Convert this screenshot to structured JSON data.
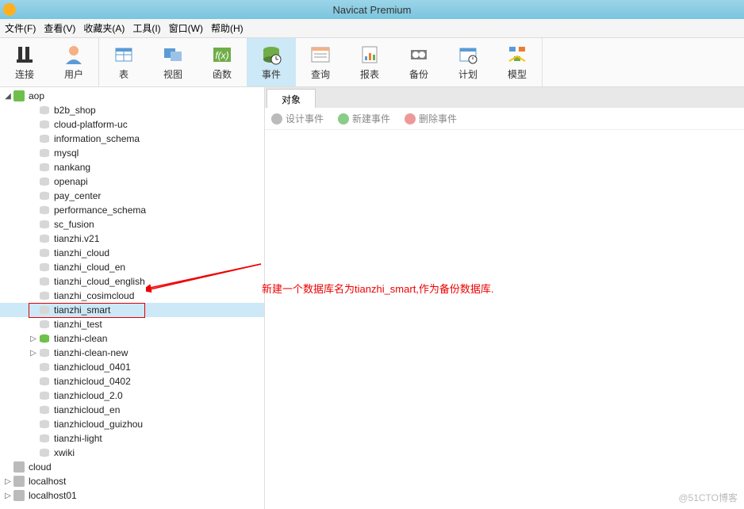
{
  "title": "Navicat Premium",
  "menu": [
    "文件(F)",
    "查看(V)",
    "收藏夹(A)",
    "工具(I)",
    "窗口(W)",
    "帮助(H)"
  ],
  "toolbar": [
    {
      "label": "连接",
      "icon": "plug"
    },
    {
      "label": "用户",
      "icon": "user"
    },
    {
      "label": "表",
      "icon": "table"
    },
    {
      "label": "视图",
      "icon": "view"
    },
    {
      "label": "函数",
      "icon": "fx"
    },
    {
      "label": "事件",
      "icon": "event",
      "active": true
    },
    {
      "label": "查询",
      "icon": "query"
    },
    {
      "label": "报表",
      "icon": "report"
    },
    {
      "label": "备份",
      "icon": "backup"
    },
    {
      "label": "计划",
      "icon": "plan"
    },
    {
      "label": "模型",
      "icon": "model"
    }
  ],
  "tree": {
    "connections": [
      {
        "name": "aop",
        "open": true,
        "active": true,
        "dbs": [
          {
            "name": "b2b_shop"
          },
          {
            "name": "cloud-platform-uc"
          },
          {
            "name": "information_schema"
          },
          {
            "name": "mysql"
          },
          {
            "name": "nankang"
          },
          {
            "name": "openapi"
          },
          {
            "name": "pay_center"
          },
          {
            "name": "performance_schema"
          },
          {
            "name": "sc_fusion"
          },
          {
            "name": "tianzhi.v21"
          },
          {
            "name": "tianzhi_cloud"
          },
          {
            "name": "tianzhi_cloud_en"
          },
          {
            "name": "tianzhi_cloud_english"
          },
          {
            "name": "tianzhi_cosimcloud"
          },
          {
            "name": "tianzhi_smart",
            "selected": true,
            "boxed": true
          },
          {
            "name": "tianzhi_test"
          },
          {
            "name": "tianzhi-clean",
            "open": true,
            "active": true,
            "expand": true
          },
          {
            "name": "tianzhi-clean-new",
            "expand": true
          },
          {
            "name": "tianzhicloud_0401"
          },
          {
            "name": "tianzhicloud_0402"
          },
          {
            "name": "tianzhicloud_2.0"
          },
          {
            "name": "tianzhicloud_en"
          },
          {
            "name": "tianzhicloud_guizhou"
          },
          {
            "name": "tianzhi-light"
          },
          {
            "name": "xwiki"
          }
        ]
      },
      {
        "name": "cloud"
      },
      {
        "name": "localhost",
        "expand": true
      },
      {
        "name": "localhost01",
        "expand": true
      }
    ]
  },
  "tab_label": "对象",
  "sub_toolbar": [
    {
      "label": "设计事件",
      "icon": "design"
    },
    {
      "label": "新建事件",
      "icon": "new"
    },
    {
      "label": "删除事件",
      "icon": "delete"
    }
  ],
  "annotation": "新建一个数据库名为tianzhi_smart,作为备份数据库.",
  "watermark": "@51CTO博客"
}
